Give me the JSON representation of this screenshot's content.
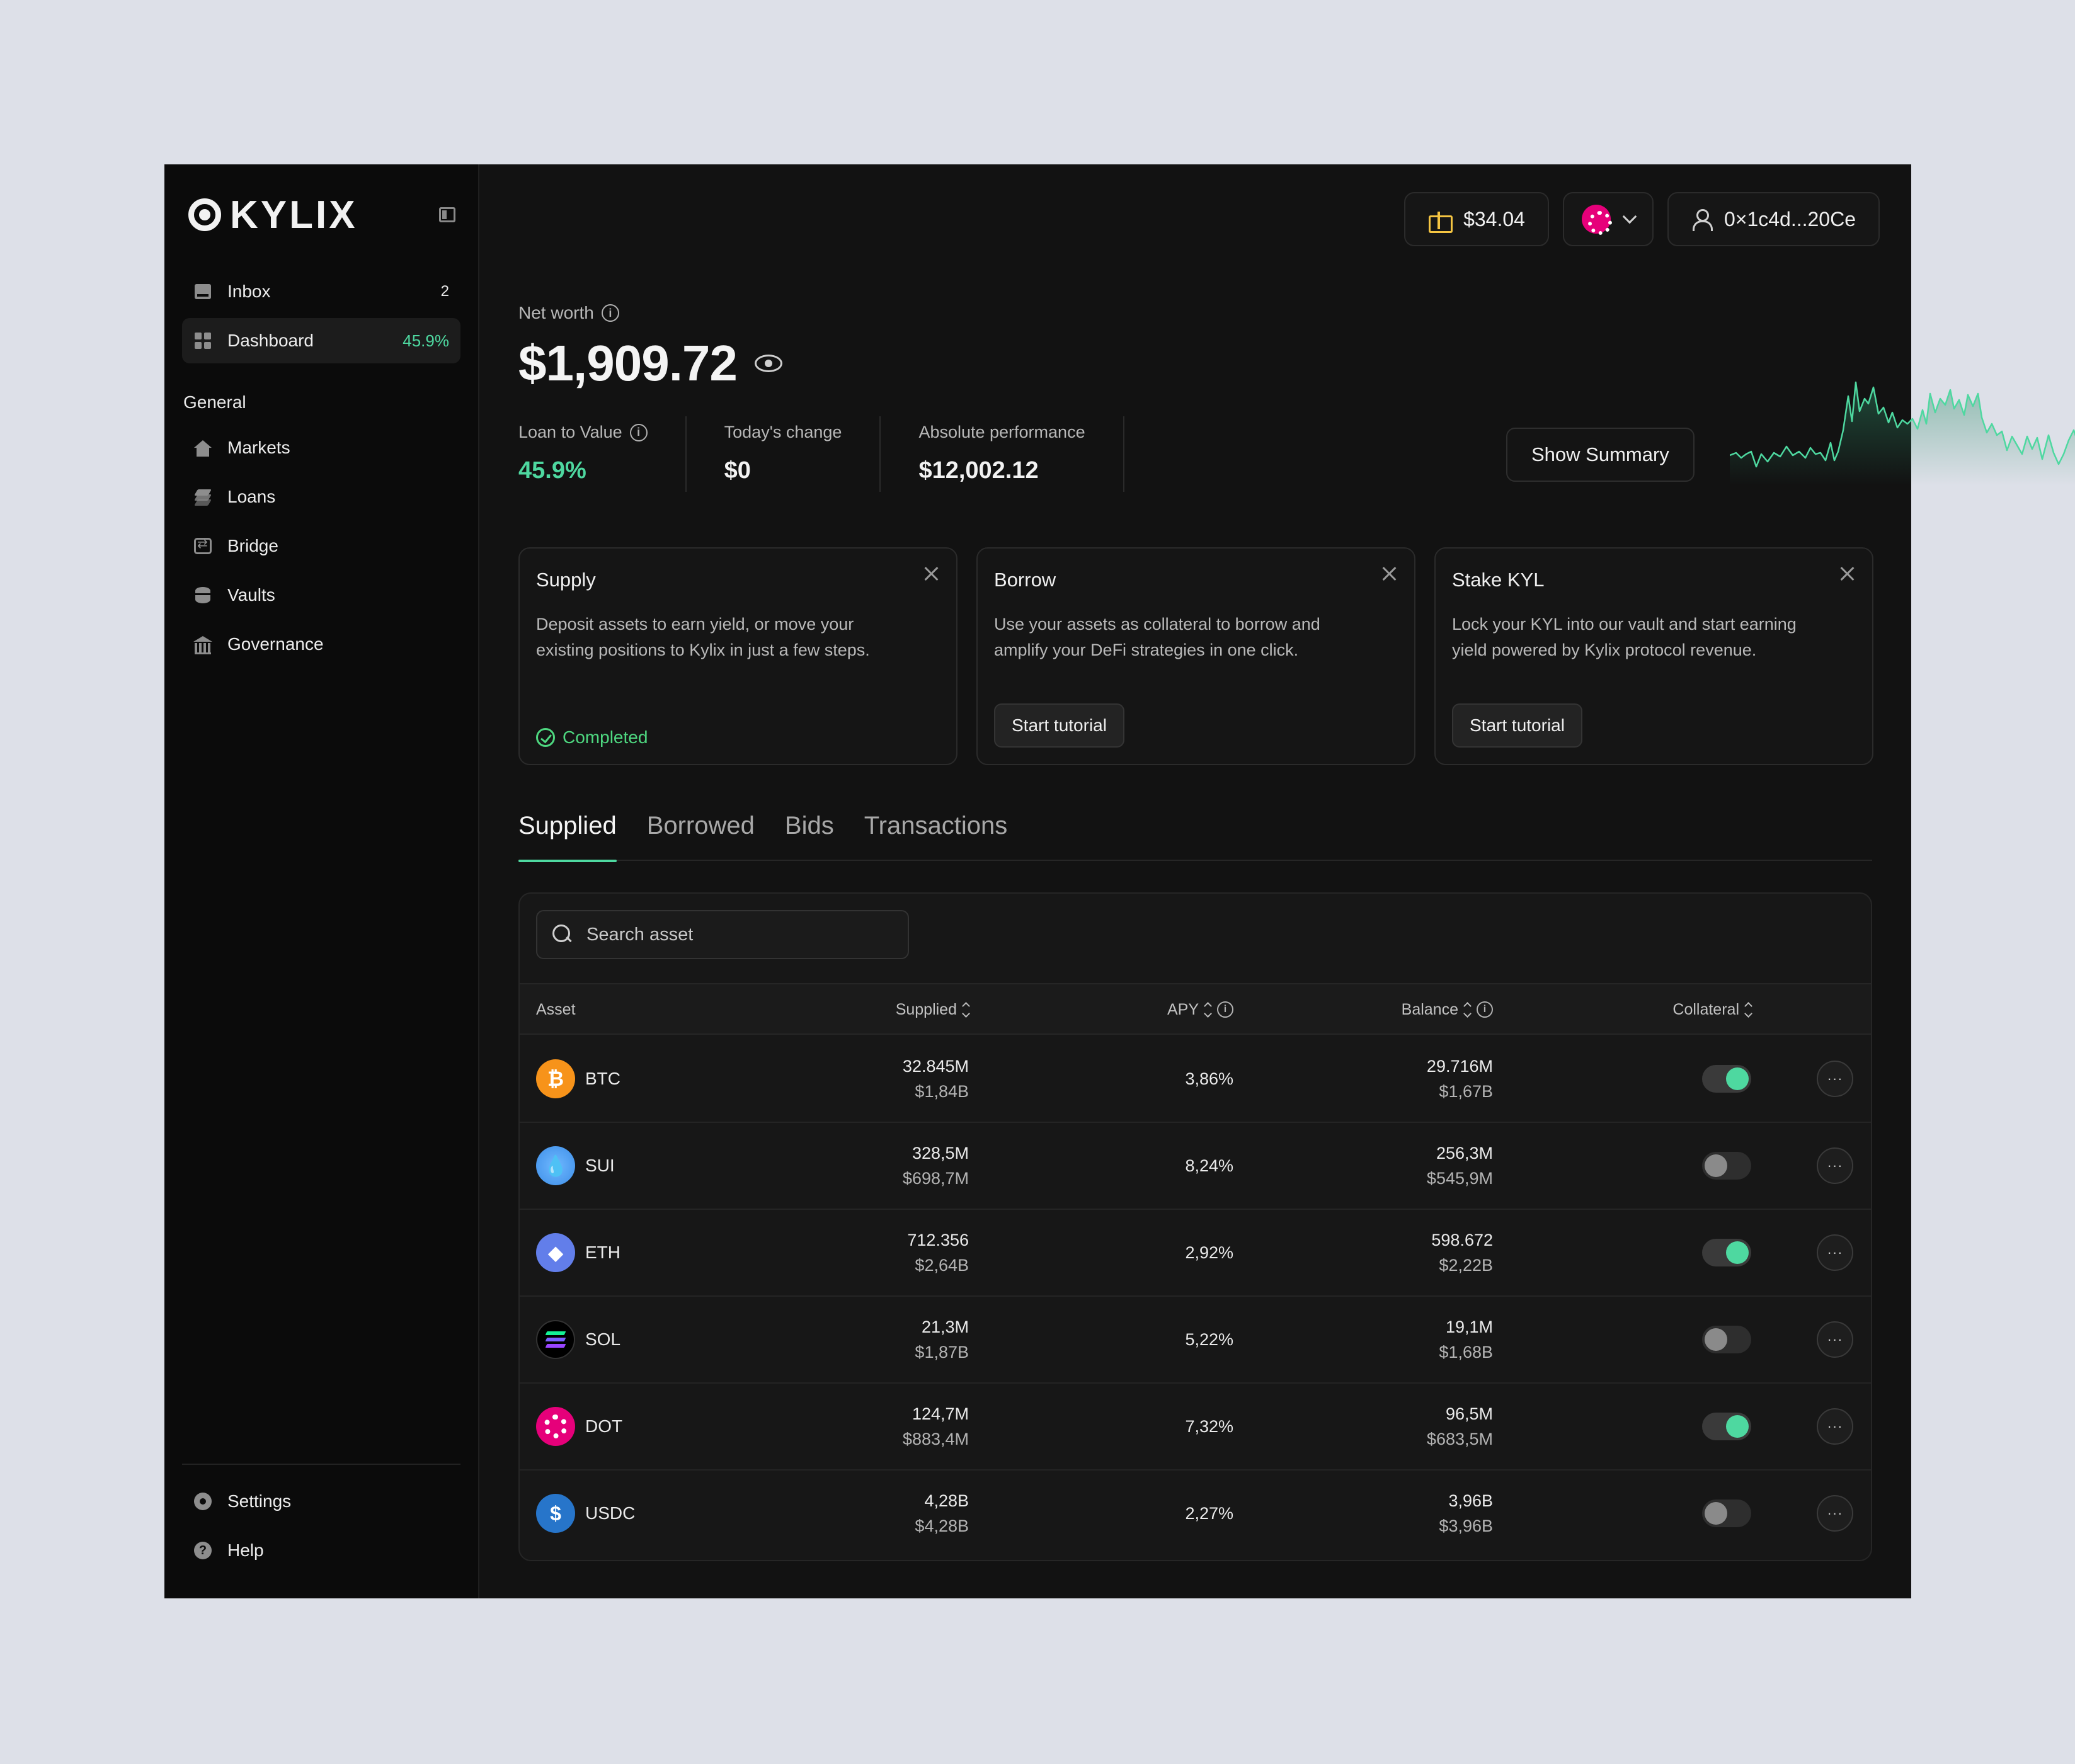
{
  "brand": {
    "name": "KYLIX"
  },
  "sidebar": {
    "top_items": [
      {
        "label": "Inbox",
        "badge": "2"
      },
      {
        "label": "Dashboard",
        "badge": "45.9%"
      }
    ],
    "section_title": "General",
    "items": [
      {
        "label": "Markets",
        "icon": "home-icon"
      },
      {
        "label": "Loans",
        "icon": "layers-icon"
      },
      {
        "label": "Bridge",
        "icon": "bridge-icon"
      },
      {
        "label": "Vaults",
        "icon": "database-icon"
      },
      {
        "label": "Governance",
        "icon": "bank-icon"
      }
    ],
    "bottom_items": [
      {
        "label": "Settings",
        "icon": "gear-icon"
      },
      {
        "label": "Help",
        "icon": "help-icon"
      }
    ]
  },
  "header": {
    "rewards": "$34.04",
    "wallet": "0×1c4d...20Ce"
  },
  "overview": {
    "net_worth_label": "Net worth",
    "net_worth": "$1,909.72",
    "metrics": [
      {
        "label": "Loan to Value",
        "value": "45.9%"
      },
      {
        "label": "Today's change",
        "value": "$0"
      },
      {
        "label": "Absolute performance",
        "value": "$12,002.12"
      }
    ],
    "summary_button": "Show Summary"
  },
  "cards": [
    {
      "title": "Supply",
      "desc": "Deposit assets to earn yield, or move your existing positions to Kylix in just a few steps.",
      "status": "Completed"
    },
    {
      "title": "Borrow",
      "desc": "Use your assets as collateral to borrow and amplify your DeFi strategies in one click.",
      "button": "Start tutorial"
    },
    {
      "title": "Stake KYL",
      "desc": "Lock your KYL into our vault and start earning yield powered by Kylix protocol revenue.",
      "button": "Start tutorial"
    }
  ],
  "tabs": [
    "Supplied",
    "Borrowed",
    "Bids",
    "Transactions"
  ],
  "table": {
    "search_placeholder": "Search asset",
    "headers": {
      "asset": "Asset",
      "supplied": "Supplied",
      "apy": "APY",
      "balance": "Balance",
      "collateral": "Collateral"
    },
    "rows": [
      {
        "asset": "BTC",
        "supplied": "32.845M",
        "supplied_usd": "$1,84B",
        "apy": "3,86%",
        "balance": "29.716M",
        "balance_usd": "$1,67B",
        "collateral": true
      },
      {
        "asset": "SUI",
        "supplied": "328,5M",
        "supplied_usd": "$698,7M",
        "apy": "8,24%",
        "balance": "256,3M",
        "balance_usd": "$545,9M",
        "collateral": false
      },
      {
        "asset": "ETH",
        "supplied": "712.356",
        "supplied_usd": "$2,64B",
        "apy": "2,92%",
        "balance": "598.672",
        "balance_usd": "$2,22B",
        "collateral": true
      },
      {
        "asset": "SOL",
        "supplied": "21,3M",
        "supplied_usd": "$1,87B",
        "apy": "5,22%",
        "balance": "19,1M",
        "balance_usd": "$1,68B",
        "collateral": false
      },
      {
        "asset": "DOT",
        "supplied": "124,7M",
        "supplied_usd": "$883,4M",
        "apy": "7,32%",
        "balance": "96,5M",
        "balance_usd": "$683,5M",
        "collateral": true
      },
      {
        "asset": "USDC",
        "supplied": "4,28B",
        "supplied_usd": "$4,28B",
        "apy": "2,27%",
        "balance": "3,96B",
        "balance_usd": "$3,96B",
        "collateral": false
      }
    ]
  },
  "colors": {
    "accent": "#4ed8a0",
    "background": "#121212",
    "sidebar": "#0b0b0b"
  }
}
